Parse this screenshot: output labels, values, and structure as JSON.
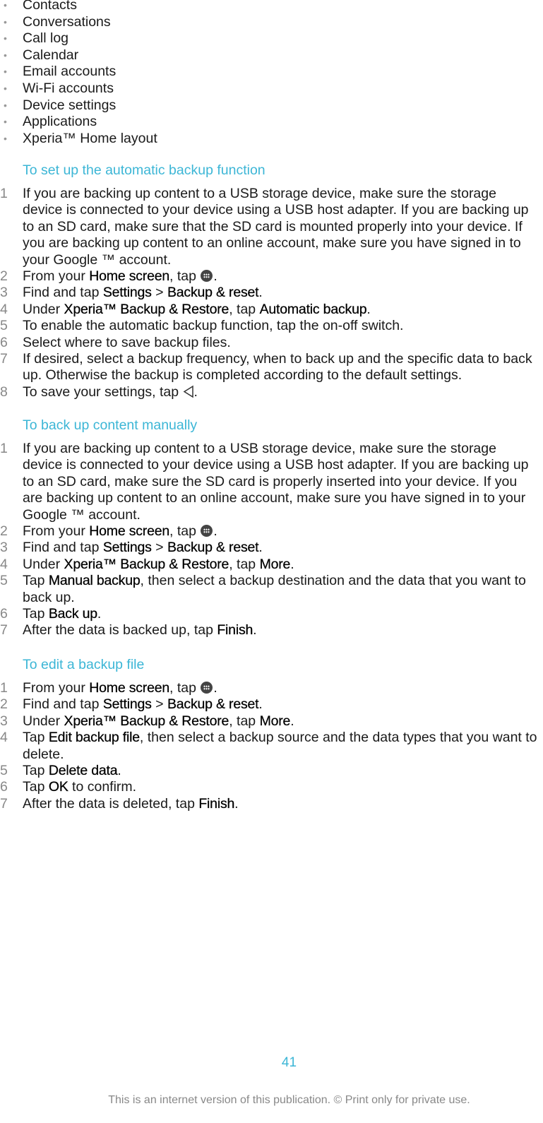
{
  "bullet_list": [
    "Contacts",
    "Conversations",
    "Call log",
    "Calendar",
    "Email accounts",
    "Wi-Fi accounts",
    "Device settings",
    "Applications",
    "Xperia™ Home layout"
  ],
  "sections": [
    {
      "heading": "To set up the automatic backup function",
      "steps": [
        {
          "num": "1",
          "parts": [
            {
              "t": "If you are backing up content to a USB storage device, make sure the storage device is connected to your device using a USB host adapter. If you are backing up to an SD card, make sure that the SD card is mounted properly into your device. If you are backing up content to an online account, make sure you have signed in to your Google ™ account."
            }
          ]
        },
        {
          "num": "2",
          "parts": [
            {
              "t": "From your "
            },
            {
              "b": "Home screen"
            },
            {
              "t": ", tap "
            },
            {
              "icon": "apps-icon"
            },
            {
              "t": "."
            }
          ]
        },
        {
          "num": "3",
          "parts": [
            {
              "t": "Find and tap "
            },
            {
              "b": "Settings"
            },
            {
              "t": " > "
            },
            {
              "b": "Backup & reset"
            },
            {
              "t": "."
            }
          ]
        },
        {
          "num": "4",
          "parts": [
            {
              "t": "Under "
            },
            {
              "b": "Xperia™ Backup & Restore"
            },
            {
              "t": ", tap "
            },
            {
              "b": "Automatic backup"
            },
            {
              "t": "."
            }
          ]
        },
        {
          "num": "5",
          "parts": [
            {
              "t": "To enable the automatic backup function, tap the on-off switch."
            }
          ]
        },
        {
          "num": "6",
          "parts": [
            {
              "t": "Select where to save backup files."
            }
          ]
        },
        {
          "num": "7",
          "parts": [
            {
              "t": "If desired, select a backup frequency, when to back up and the specific data to back up. Otherwise the backup is completed according to the default settings."
            }
          ]
        },
        {
          "num": "8",
          "parts": [
            {
              "t": "To save your settings, tap "
            },
            {
              "icon": "back-icon"
            },
            {
              "t": "."
            }
          ]
        }
      ]
    },
    {
      "heading": "To back up content manually",
      "steps": [
        {
          "num": "1",
          "parts": [
            {
              "t": "If you are backing up content to a USB storage device, make sure the storage device is connected to your device using a USB host adapter. If you are backing up to an SD card, make sure the SD card is properly inserted into your device. If you are backing up content to an online account, make sure you have signed in to your Google ™ account."
            }
          ]
        },
        {
          "num": "2",
          "parts": [
            {
              "t": "From your "
            },
            {
              "b": "Home screen"
            },
            {
              "t": ", tap "
            },
            {
              "icon": "apps-icon"
            },
            {
              "t": "."
            }
          ]
        },
        {
          "num": "3",
          "parts": [
            {
              "t": "Find and tap "
            },
            {
              "b": "Settings"
            },
            {
              "t": " > "
            },
            {
              "b": "Backup & reset"
            },
            {
              "t": "."
            }
          ]
        },
        {
          "num": "4",
          "parts": [
            {
              "t": "Under "
            },
            {
              "b": "Xperia™ Backup & Restore"
            },
            {
              "t": ", tap "
            },
            {
              "b": "More"
            },
            {
              "t": "."
            }
          ]
        },
        {
          "num": "5",
          "parts": [
            {
              "t": "Tap "
            },
            {
              "b": "Manual backup"
            },
            {
              "t": ", then select a backup destination and the data that you want to back up."
            }
          ]
        },
        {
          "num": "6",
          "parts": [
            {
              "t": "Tap "
            },
            {
              "b": "Back up"
            },
            {
              "t": "."
            }
          ]
        },
        {
          "num": "7",
          "parts": [
            {
              "t": "After the data is backed up, tap "
            },
            {
              "b": "Finish"
            },
            {
              "t": "."
            }
          ]
        }
      ]
    },
    {
      "heading": "To edit a backup file",
      "steps": [
        {
          "num": "1",
          "parts": [
            {
              "t": "From your "
            },
            {
              "b": "Home screen"
            },
            {
              "t": ", tap "
            },
            {
              "icon": "apps-icon"
            },
            {
              "t": "."
            }
          ]
        },
        {
          "num": "2",
          "parts": [
            {
              "t": "Find and tap "
            },
            {
              "b": "Settings"
            },
            {
              "t": " > "
            },
            {
              "b": "Backup & reset"
            },
            {
              "t": "."
            }
          ]
        },
        {
          "num": "3",
          "parts": [
            {
              "t": "Under "
            },
            {
              "b": "Xperia™ Backup & Restore"
            },
            {
              "t": ", tap "
            },
            {
              "b": "More"
            },
            {
              "t": "."
            }
          ]
        },
        {
          "num": "4",
          "parts": [
            {
              "t": "Tap "
            },
            {
              "b": "Edit backup file"
            },
            {
              "t": ", then select a backup source and the data types that you want to delete."
            }
          ]
        },
        {
          "num": "5",
          "parts": [
            {
              "t": "Tap "
            },
            {
              "b": "Delete data"
            },
            {
              "t": "."
            }
          ]
        },
        {
          "num": "6",
          "parts": [
            {
              "t": "Tap "
            },
            {
              "b": "OK"
            },
            {
              "t": " to confirm."
            }
          ]
        },
        {
          "num": "7",
          "parts": [
            {
              "t": "After the data is deleted, tap "
            },
            {
              "b": "Finish"
            },
            {
              "t": "."
            }
          ]
        }
      ]
    }
  ],
  "page_number": "41",
  "footer": "This is an internet version of this publication. © Print only for private use.",
  "colors": {
    "heading": "#3cb6d6",
    "body_text": "#1a1a1a",
    "step_number": "#888888",
    "footer": "#888888"
  }
}
